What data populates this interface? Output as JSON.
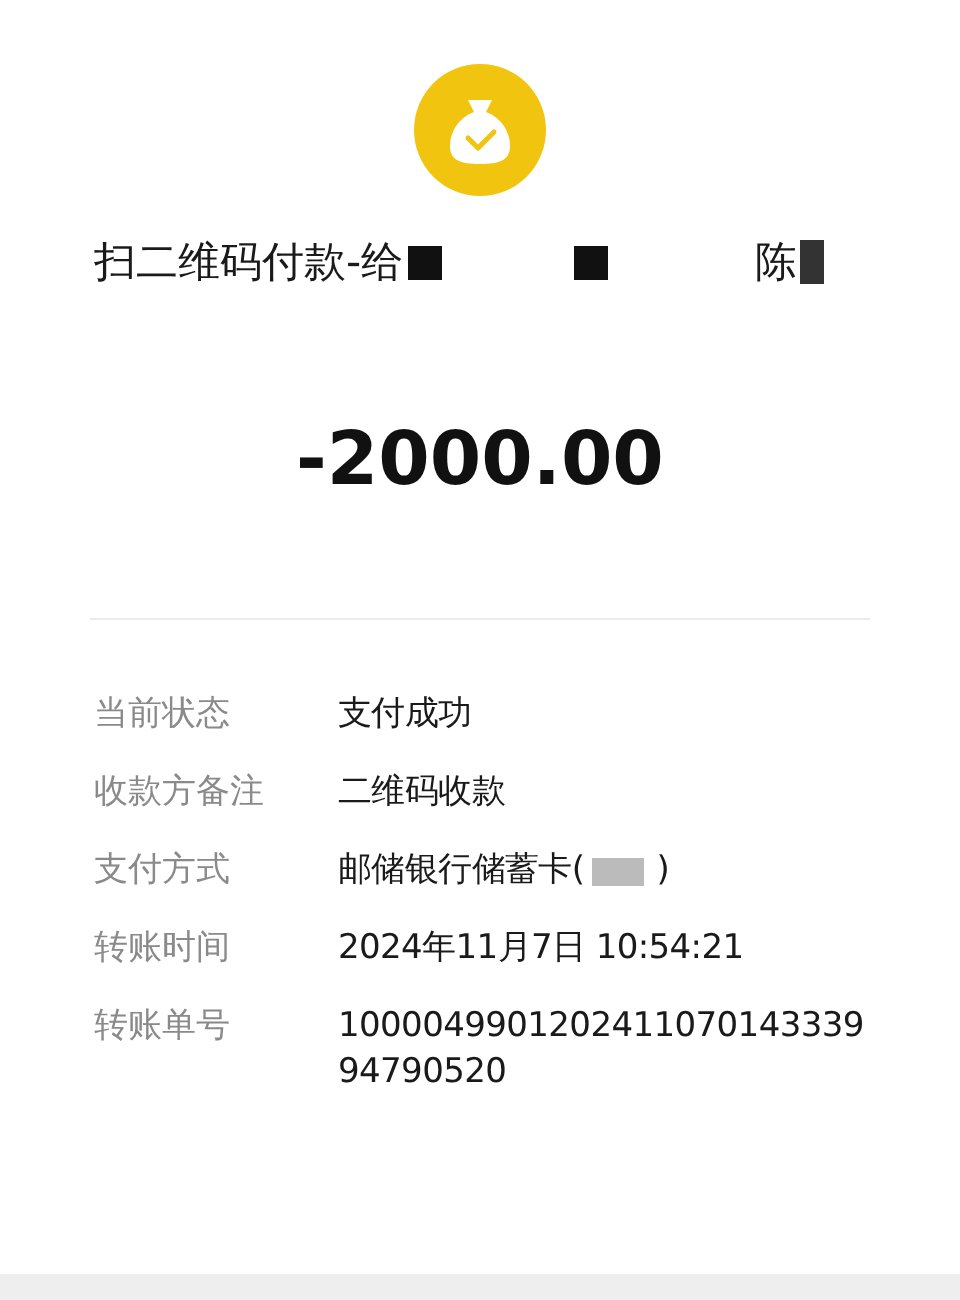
{
  "header": {
    "title_start": "扫二维码付款-给",
    "title_end": "陈"
  },
  "amount": "-2000.00",
  "details": [
    {
      "kind": "plain",
      "label": "当前状态",
      "value": "支付成功"
    },
    {
      "kind": "plain",
      "label": "收款方备注",
      "value": "二维码收款"
    },
    {
      "kind": "masked",
      "label": "支付方式",
      "value": "邮储银行储蓄卡(",
      "value_end": ")"
    },
    {
      "kind": "plain",
      "label": "转账时间",
      "value": "2024年11月7日 10:54:21"
    },
    {
      "kind": "plain",
      "label": "转账单号",
      "value": "100004990120241107014333994790520"
    }
  ]
}
